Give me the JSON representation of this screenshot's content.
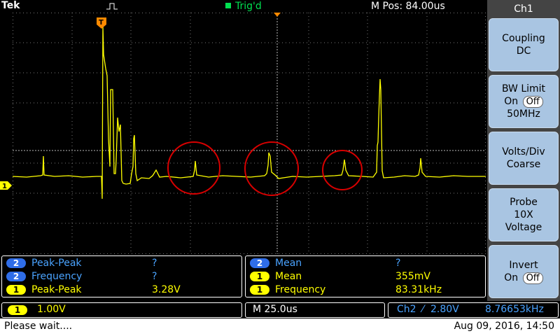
{
  "top": {
    "brand": "Tek",
    "trigger_status": "Trig'd",
    "m_pos": "M Pos: 84.00us"
  },
  "side_menu": {
    "title": "Ch1",
    "coupling": {
      "line1": "Coupling",
      "line2": "DC"
    },
    "bw_limit": {
      "line1": "BW Limit",
      "on": "On",
      "off": "Off",
      "line3": "50MHz"
    },
    "volts_div": {
      "line1": "Volts/Div",
      "line2": "Coarse"
    },
    "probe": {
      "line1": "Probe",
      "line2": "10X",
      "line3": "Voltage"
    },
    "invert": {
      "line1": "Invert",
      "on": "On",
      "off": "Off"
    }
  },
  "measurements_left": [
    {
      "ch": "2",
      "name": "Peak-Peak",
      "value": "?"
    },
    {
      "ch": "2",
      "name": "Frequency",
      "value": "?"
    },
    {
      "ch": "1",
      "name": "Peak-Peak",
      "value": "3.28V"
    }
  ],
  "measurements_right": [
    {
      "ch": "2",
      "name": "Mean",
      "value": "?"
    },
    {
      "ch": "1",
      "name": "Mean",
      "value": "355mV"
    },
    {
      "ch": "1",
      "name": "Frequency",
      "value": "83.31kHz"
    }
  ],
  "status": {
    "ch1_chip": "1",
    "ch1_scale": "1.00V",
    "timebase": "M 25.0us",
    "trig_source": "Ch2",
    "trig_slope": "⁄",
    "trig_level": "2.80V",
    "trig_freq": "8.76653kHz"
  },
  "bottom": {
    "message": "Please wait....",
    "datetime": "Aug 09, 2016, 14:50"
  },
  "colors": {
    "ch1": "#ffff00",
    "ch2": "#2f6de8",
    "annotation": "#d80000",
    "trig": "#00e050"
  },
  "ch1_marker_label": "1",
  "trigger_marker_label": "T"
}
